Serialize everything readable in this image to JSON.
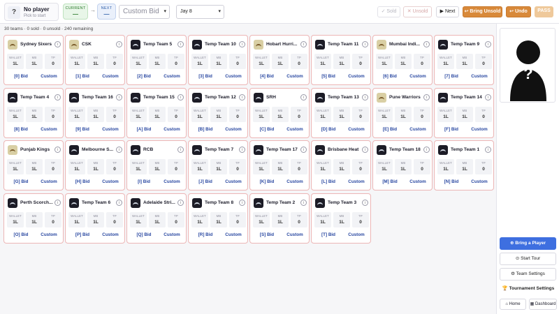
{
  "topbar": {
    "no_player": "No player",
    "pick_to_start": "Pick to start",
    "current_label": "CURRENT",
    "current_value": "—",
    "next_label": "NEXT",
    "next_value": "—",
    "custom_bid_placeholder": "Custom Bid",
    "player_select": "Jay 8",
    "sold_label": "✓ Sold",
    "unsold_label": "✕ Unsold",
    "next_btn": "▶ Next",
    "bring_unsold": "↩ Bring Unsold",
    "undo": "↩ Undo",
    "pass": "PASS"
  },
  "summary": "30 teams · 0 sold · 0 unsold · 240 remaining",
  "stat_labels": {
    "wallet": "WALLET",
    "mb": "MB",
    "tp": "TP"
  },
  "custom_label": "Custom",
  "teams": [
    {
      "name": "Sydney Sixers",
      "wallet": "1L",
      "mb": "1L",
      "tp": "0",
      "bid": "[0] Bid",
      "logo": "img"
    },
    {
      "name": "CSK",
      "wallet": "1L",
      "mb": "1L",
      "tp": "0",
      "bid": "[1] Bid",
      "logo": "img"
    },
    {
      "name": "Temp Team 5",
      "wallet": "1L",
      "mb": "1L",
      "tp": "0",
      "bid": "[2] Bid",
      "logo": "dark"
    },
    {
      "name": "Temp Team 10",
      "wallet": "1L",
      "mb": "1L",
      "tp": "0",
      "bid": "[3] Bid",
      "logo": "dark"
    },
    {
      "name": "Hobart Hurri...",
      "wallet": "1L",
      "mb": "1L",
      "tp": "0",
      "bid": "[4] Bid",
      "logo": "img"
    },
    {
      "name": "Temp Team 11",
      "wallet": "1L",
      "mb": "1L",
      "tp": "0",
      "bid": "[5] Bid",
      "logo": "dark"
    },
    {
      "name": "Mumbai Indi...",
      "wallet": "1L",
      "mb": "1L",
      "tp": "0",
      "bid": "[6] Bid",
      "logo": "img"
    },
    {
      "name": "Temp Team 9",
      "wallet": "1L",
      "mb": "1L",
      "tp": "0",
      "bid": "[7] Bid",
      "logo": "dark"
    },
    {
      "name": "Temp Team 4",
      "wallet": "1L",
      "mb": "1L",
      "tp": "0",
      "bid": "[8] Bid",
      "logo": "dark"
    },
    {
      "name": "Temp Team 16",
      "wallet": "1L",
      "mb": "1L",
      "tp": "0",
      "bid": "[9] Bid",
      "logo": "dark"
    },
    {
      "name": "Temp Team 15",
      "wallet": "1L",
      "mb": "1L",
      "tp": "0",
      "bid": "[A] Bid",
      "logo": "dark"
    },
    {
      "name": "Temp Team 12",
      "wallet": "1L",
      "mb": "1L",
      "tp": "0",
      "bid": "[B] Bid",
      "logo": "dark"
    },
    {
      "name": "SRH",
      "wallet": "1L",
      "mb": "1L",
      "tp": "0",
      "bid": "[C] Bid",
      "logo": "dark"
    },
    {
      "name": "Temp Team 13",
      "wallet": "1L",
      "mb": "1L",
      "tp": "0",
      "bid": "[D] Bid",
      "logo": "dark"
    },
    {
      "name": "Pune Warriors",
      "wallet": "1L",
      "mb": "1L",
      "tp": "0",
      "bid": "[E] Bid",
      "logo": "img"
    },
    {
      "name": "Temp Team 14",
      "wallet": "1L",
      "mb": "1L",
      "tp": "0",
      "bid": "[F] Bid",
      "logo": "dark"
    },
    {
      "name": "Punjab Kings",
      "wallet": "1L",
      "mb": "1L",
      "tp": "0",
      "bid": "[G] Bid",
      "logo": "img"
    },
    {
      "name": "Melbourne S...",
      "wallet": "1L",
      "mb": "1L",
      "tp": "0",
      "bid": "[H] Bid",
      "logo": "dark"
    },
    {
      "name": "RCB",
      "wallet": "1L",
      "mb": "1L",
      "tp": "0",
      "bid": "[I] Bid",
      "logo": "dark"
    },
    {
      "name": "Temp Team 7",
      "wallet": "1L",
      "mb": "1L",
      "tp": "0",
      "bid": "[J] Bid",
      "logo": "dark"
    },
    {
      "name": "Temp Team 17",
      "wallet": "1L",
      "mb": "1L",
      "tp": "0",
      "bid": "[K] Bid",
      "logo": "dark"
    },
    {
      "name": "Brisbane Heat",
      "wallet": "1L",
      "mb": "1L",
      "tp": "0",
      "bid": "[L] Bid",
      "logo": "dark"
    },
    {
      "name": "Temp Team 18",
      "wallet": "1L",
      "mb": "1L",
      "tp": "0",
      "bid": "[M] Bid",
      "logo": "dark"
    },
    {
      "name": "Temp Team 1",
      "wallet": "1L",
      "mb": "1L",
      "tp": "0",
      "bid": "[N] Bid",
      "logo": "dark"
    },
    {
      "name": "Perth Scorch...",
      "wallet": "1L",
      "mb": "1L",
      "tp": "0",
      "bid": "[O] Bid",
      "logo": "dark"
    },
    {
      "name": "Temp Team 6",
      "wallet": "1L",
      "mb": "1L",
      "tp": "0",
      "bid": "[P] Bid",
      "logo": "dark"
    },
    {
      "name": "Adelaide Stri...",
      "wallet": "1L",
      "mb": "1L",
      "tp": "0",
      "bid": "[Q] Bid",
      "logo": "dark"
    },
    {
      "name": "Temp Team 8",
      "wallet": "1L",
      "mb": "1L",
      "tp": "0",
      "bid": "[R] Bid",
      "logo": "dark"
    },
    {
      "name": "Temp Team 2",
      "wallet": "1L",
      "mb": "1L",
      "tp": "0",
      "bid": "[S] Bid",
      "logo": "dark"
    },
    {
      "name": "Temp Team 3",
      "wallet": "1L",
      "mb": "1L",
      "tp": "0",
      "bid": "[T] Bid",
      "logo": "dark"
    }
  ],
  "sidebar": {
    "bring_player": "⊕ Bring a Player",
    "start_tour": "⊙ Start Tour",
    "team_settings": "⚙ Team Settings",
    "tournament_settings": "🏆 Tournament Settings",
    "home": "⌂ Home",
    "dashboard": "▦ Dashboard"
  },
  "colors": {
    "accent": "#3e6fe0",
    "orange": "#d8893a",
    "card_border": "#ecb5b5",
    "bid_text": "#2746a0"
  }
}
